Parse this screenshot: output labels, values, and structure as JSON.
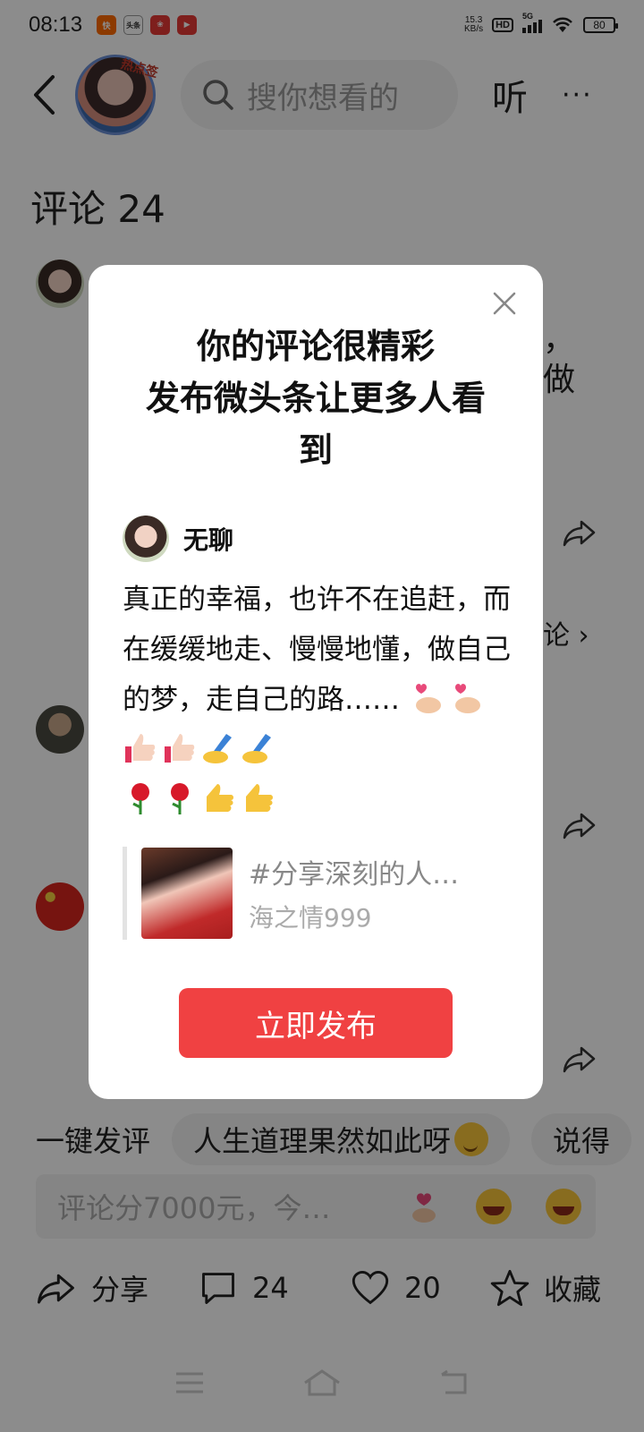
{
  "status_bar": {
    "time": "08:13",
    "app_icons": [
      {
        "name": "kuaishou-icon",
        "color": "#ff6a00",
        "glyph": "快"
      },
      {
        "name": "toutiao-icon",
        "color": "#ffffff",
        "glyph": "头条"
      },
      {
        "name": "red-app-icon",
        "color": "#e53935",
        "glyph": "❀"
      },
      {
        "name": "video-app-icon",
        "color": "#e53935",
        "glyph": "▶"
      }
    ],
    "net_speed_value": "15.3",
    "net_speed_unit": "KB/s",
    "hd_label": "HD",
    "network_label": "5G",
    "battery": "80"
  },
  "header": {
    "avatar_tag": "热点签",
    "search_placeholder": "搜你想看的",
    "listen_label": "听",
    "more_label": "···"
  },
  "comments": {
    "title": "评论 24",
    "peek_texts": [
      "，",
      "做",
      "论 ›"
    ]
  },
  "modal": {
    "title_line1": "你的评论很精彩",
    "title_line2": "发布微头条让更多人看",
    "title_line3": "到",
    "user_name": "无聊",
    "content": "真正的幸福，也许不在追赶，而在缓缓地走、慢慢地懂，做自己的梦，走自己的路……",
    "emojis_line1": [
      "finger-heart",
      "finger-heart",
      "thumbs-up-light",
      "thumbs-up-light",
      "writing-hand",
      "writing-hand"
    ],
    "emojis_line2": [
      "rose",
      "rose",
      "thumbs-up",
      "thumbs-up"
    ],
    "quote_title": "#分享深刻的人…",
    "quote_author": "海之情999",
    "publish_label": "立即发布",
    "close_icon": "close-icon"
  },
  "quick_reply": {
    "label": "一键发评",
    "chips": [
      "人生道理果然如此呀",
      "说得"
    ]
  },
  "input": {
    "placeholder": "评论分7000元，今…"
  },
  "actions": {
    "share_label": "分享",
    "comment_count": "24",
    "like_count": "20",
    "favorite_label": "收藏"
  },
  "colors": {
    "accent_red": "#f04142",
    "overlay": "rgba(0,0,0,0.45)"
  }
}
